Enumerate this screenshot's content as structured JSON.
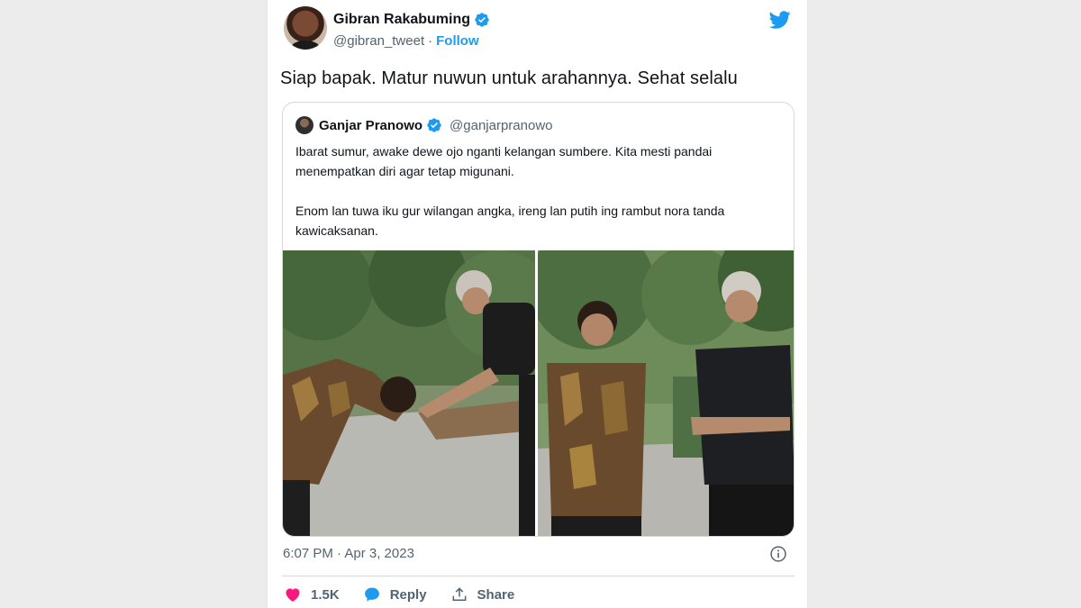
{
  "tweet": {
    "author": {
      "name": "Gibran Rakabuming",
      "handle": "@gibran_tweet",
      "separator": "·",
      "follow_label": "Follow"
    },
    "text": "Siap bapak. Matur nuwun untuk arahannya. Sehat selalu",
    "quoted": {
      "name": "Ganjar Pranowo",
      "handle": "@ganjarpranowo",
      "text": "Ibarat sumur, awake dewe ojo nganti kelangan sumbere. Kita mesti pandai menempatkan diri agar tetap migunani.\n\nEnom lan tuwa iku gur wilangan angka, ireng lan putih ing rambut nora tanda kawicaksanan."
    },
    "timestamp": "6:07 PM · Apr 3, 2023",
    "actions": {
      "like_count": "1.5K",
      "reply_label": "Reply",
      "share_label": "Share"
    }
  },
  "icons": {
    "brand": "twitter-bird-icon",
    "verified": "verified-badge-icon",
    "info": "info-icon",
    "like": "heart-icon",
    "reply": "reply-bubble-icon",
    "share": "share-icon"
  },
  "colors": {
    "brand": "#1d9bf0",
    "like": "#f91880",
    "text_primary": "#0f1419",
    "text_secondary": "#536471",
    "border": "#cfd9de"
  }
}
